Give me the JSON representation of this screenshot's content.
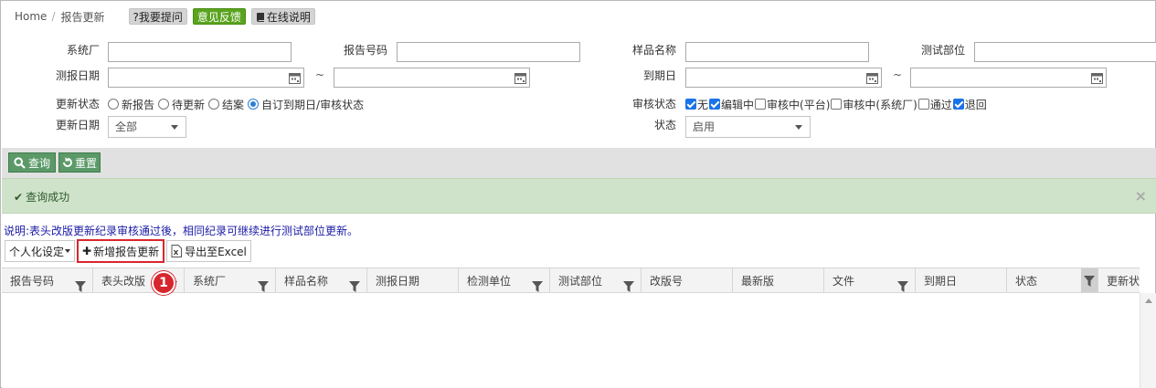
{
  "breadcrumb": {
    "home": "Home",
    "separator": "/",
    "current": "报告更新"
  },
  "header_buttons": [
    {
      "label": "?我要提问",
      "color": "#d4d4d4"
    },
    {
      "label": "意见反馈",
      "color": "#5aa31e"
    },
    {
      "label": "在线说明",
      "color": "#d4d4d4",
      "icon": "book-icon"
    }
  ],
  "filters": {
    "factory_label": "系统厂",
    "factory_value": "",
    "report_no_label": "报告号码",
    "report_no_value": "",
    "sample_name_label": "样品名称",
    "sample_name_value": "",
    "test_dept_label": "测试部位",
    "test_dept_value": "",
    "report_date_label": "测报日期",
    "report_date_from": "",
    "report_date_to": "",
    "range_sep": "~",
    "expire_date_label": "到期日",
    "expire_date_from": "",
    "expire_date_to": "",
    "update_status_label": "更新状态",
    "update_status_options": [
      {
        "label": "新报告",
        "selected": false
      },
      {
        "label": "待更新",
        "selected": false
      },
      {
        "label": "结案",
        "selected": false
      },
      {
        "label": "自订到期日/审核状态",
        "selected": true
      }
    ],
    "review_status_label": "审核状态",
    "review_status_options": [
      {
        "label": "无",
        "checked": true
      },
      {
        "label": "编辑中",
        "checked": true
      },
      {
        "label": "审核中(平台)",
        "checked": false
      },
      {
        "label": "审核中(系统厂)",
        "checked": false
      },
      {
        "label": "通过",
        "checked": false
      },
      {
        "label": "退回",
        "checked": true
      }
    ],
    "update_date_label": "更新日期",
    "update_date_value": "全部",
    "state_label": "状态",
    "state_value": "启用"
  },
  "toolbar": {
    "query_label": "查询",
    "reset_label": "重置",
    "color": "#5b9a68"
  },
  "alert": {
    "message": "查询成功",
    "close": "×",
    "color": "#cfe3ca"
  },
  "note": "说明:表头改版更新纪录审核通过後，相同纪录可继续进行测试部位更新。",
  "grid_toolbar": {
    "personalize_label": "个人化设定",
    "add_label": "新增报告更新",
    "export_label": "导出至Excel"
  },
  "callout": {
    "number": "1",
    "color": "#d7262d"
  },
  "columns": [
    {
      "label": "报告号码",
      "filter": true
    },
    {
      "label": "表头改版",
      "filter": true
    },
    {
      "label": "系统厂",
      "filter": true
    },
    {
      "label": "样品名称",
      "filter": true
    },
    {
      "label": "测报日期",
      "filter": false
    },
    {
      "label": "检测单位",
      "filter": true
    },
    {
      "label": "测试部位",
      "filter": true
    },
    {
      "label": "改版号",
      "filter": false
    },
    {
      "label": "最新版",
      "filter": false
    },
    {
      "label": "文件",
      "filter": true
    },
    {
      "label": "到期日",
      "filter": false
    },
    {
      "label": "状态",
      "filter": true
    },
    {
      "label": "更新状",
      "filter": false
    }
  ]
}
